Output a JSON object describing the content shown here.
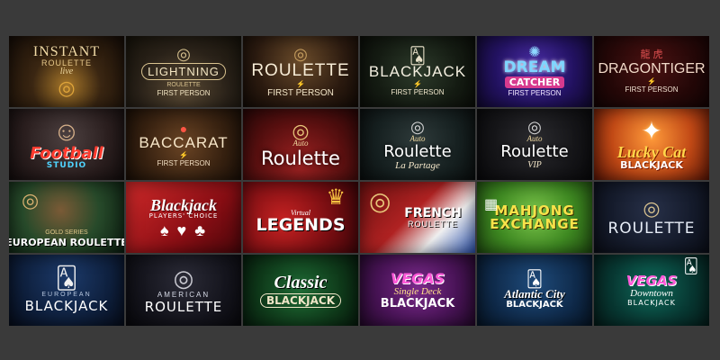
{
  "lobby": {
    "tiles": [
      {
        "title": "INSTANT",
        "sub": "ROULETTE",
        "extra": "live",
        "icon": "roulette-wheel-icon"
      },
      {
        "title": "LIGHTNING",
        "sub": "ROULETTE",
        "extra": "FIRST PERSON",
        "icon": "roulette-wheel-icon"
      },
      {
        "title": "ROULETTE",
        "sub": "⚡",
        "extra": "FIRST PERSON",
        "icon": "roulette-wheel-icon"
      },
      {
        "title": "BLACKJACK",
        "sub": "⚡",
        "extra": "FIRST PERSON",
        "icon": "playing-cards-icon"
      },
      {
        "title": "DREAM",
        "sub": "CATCHER",
        "extra": "FIRST PERSON",
        "icon": "money-wheel-icon"
      },
      {
        "title": "DRAGONTIGER",
        "sub": "⚡",
        "extra": "FIRST PERSON",
        "icon": "dragon-tiger-glyphs-icon"
      },
      {
        "title": "Football",
        "sub": "STUDIO",
        "icon": "dealer-portrait-icon"
      },
      {
        "title": "BACCARAT",
        "sub": "⚡",
        "extra": "FIRST PERSON",
        "icon": "baccarat-chip-icon"
      },
      {
        "title": "Roulette",
        "sub": "Auto",
        "icon": "roulette-wheel-icon"
      },
      {
        "title": "Roulette",
        "sub": "Auto",
        "extra": "La Partage",
        "icon": "roulette-wheel-icon"
      },
      {
        "title": "Roulette",
        "sub": "Auto",
        "extra": "VIP",
        "icon": "roulette-wheel-icon"
      },
      {
        "title": "Lucky Cat",
        "sub": "BLACKJACK",
        "icon": "lucky-cat-icon"
      },
      {
        "title": "EUROPEAN ROULETTE",
        "sub": "GOLD SERIES",
        "icon": "roulette-wheel-icon"
      },
      {
        "title": "Blackjack",
        "sub": "PLAYERS' CHOICE",
        "icon": "card-fan-icon"
      },
      {
        "title": "LEGENDS",
        "sub": "Virtual",
        "icon": "golden-mask-icon"
      },
      {
        "title": "FRENCH",
        "sub": "ROULETTE",
        "icon": "roulette-wheel-icon"
      },
      {
        "title": "MAHJONG",
        "sub": "EXCHANGE",
        "icon": "mahjong-tiles-icon"
      },
      {
        "title": "ROULETTE",
        "icon": "roulette-wheel-icon"
      },
      {
        "title": "BLACKJACK",
        "sub": "EUROPEAN",
        "icon": "playing-cards-icon"
      },
      {
        "title": "ROULETTE",
        "sub": "AMERICAN",
        "icon": "roulette-wheel-icon"
      },
      {
        "title": "Classic",
        "sub": "BLACKJACK",
        "icon": "playing-cards-icon"
      },
      {
        "title": "VEGAS",
        "sub": "Single Deck",
        "extra": "BLACKJACK",
        "icon": "playing-cards-icon"
      },
      {
        "title": "Atlantic City",
        "sub": "BLACKJACK",
        "icon": "playing-cards-icon"
      },
      {
        "title": "VEGAS",
        "sub": "Downtown",
        "extra": "BLACKJACK",
        "icon": "playing-cards-icon"
      }
    ]
  },
  "glyphs": {
    "roulette-wheel-icon": "◎",
    "playing-cards-icon": "🂡",
    "money-wheel-icon": "✺",
    "dragon-tiger-glyphs-icon": "龍 虎",
    "dealer-portrait-icon": "☺",
    "baccarat-chip-icon": "●",
    "lucky-cat-icon": "✦",
    "card-fan-icon": "♠ ♥ ♣",
    "golden-mask-icon": "♛",
    "mahjong-tiles-icon": "▦"
  }
}
